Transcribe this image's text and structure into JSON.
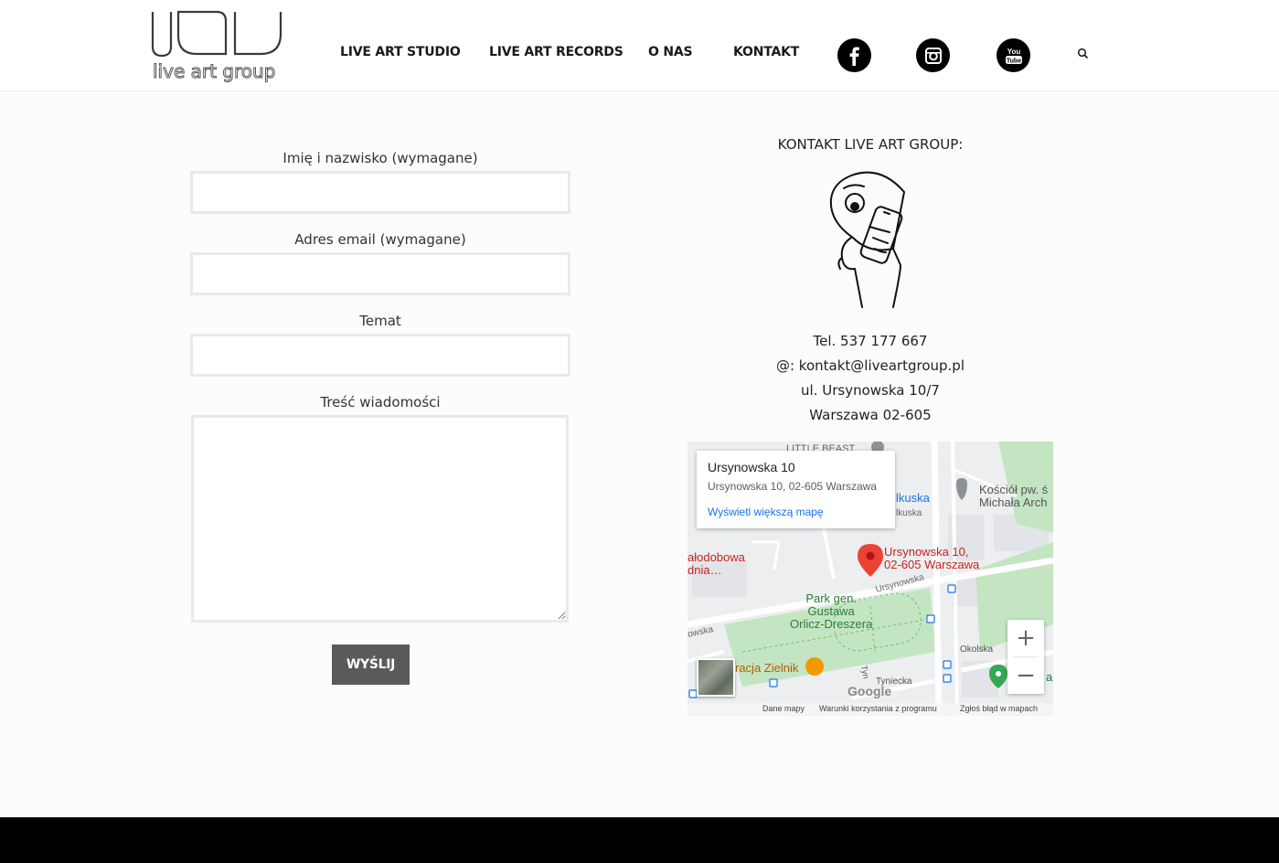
{
  "header": {
    "logo_text": "live art group",
    "nav": [
      "LIVE ART STUDIO",
      "LIVE ART RECORDS",
      "O NAS",
      "KONTAKT"
    ],
    "social": [
      "facebook-icon",
      "instagram-icon",
      "youtube-icon"
    ],
    "youtube_text": [
      "You",
      "Tube"
    ]
  },
  "form": {
    "name_label": "Imię i nazwisko (wymagane)",
    "email_label": "Adres email (wymagane)",
    "subject_label": "Temat",
    "message_label": "Treść wiadomości",
    "name_value": "",
    "email_value": "",
    "subject_value": "",
    "message_value": "",
    "submit_label": "WYŚLIJ"
  },
  "contact": {
    "title": "KONTAKT LIVE ART GROUP:",
    "phone": "Tel. 537 177 667",
    "email": "@: kontakt@liveartgroup.pl",
    "street": "ul. Ursynowska 10/7",
    "city": "Warszawa 02-605"
  },
  "map": {
    "card_title": "Ursynowska 10",
    "card_address": "Ursynowska 10, 02-605 Warszawa",
    "card_link": "Wyświetl większą mapę",
    "pin_label_1": "Ursynowska 10,",
    "pin_label_2": "02-605 Warszawa",
    "park_label_1": "Park gen.",
    "park_label_2": "Gustawa",
    "park_label_3": "Orlicz-Dreszera",
    "church_label_1": "Kościół pw. ś",
    "church_label_2": "Michała Arch",
    "poi_top": "LITTLE BEAST",
    "street_olkuska": "lkuska",
    "street_olkuska_small": "lkuska",
    "poi_left_1": "ałodobowa",
    "poi_left_2": "dnia…",
    "street_ursynowska": "Ursynowska",
    "street_left": "owska",
    "street_okolska": "Okolska",
    "street_tyniecka": "Tyniecka",
    "street_tyn": "Tyn",
    "restaurant": "racja Zielnik",
    "right_poi": "a",
    "google": "Google",
    "zoom_in": "+",
    "zoom_out": "−",
    "footer_links": [
      "Dane mapy",
      "Warunki korzystania z programu",
      "Zgłoś błąd w mapach"
    ],
    "colors": {
      "park": "#c3e5c2",
      "pin": "#ea4335",
      "link": "#1a73e8",
      "poi_green": "#34a853",
      "restaurant": "#f29900"
    }
  },
  "colors": {
    "background": "#fdfbfc",
    "button": "#5a5a5a",
    "footer": "#000000"
  }
}
